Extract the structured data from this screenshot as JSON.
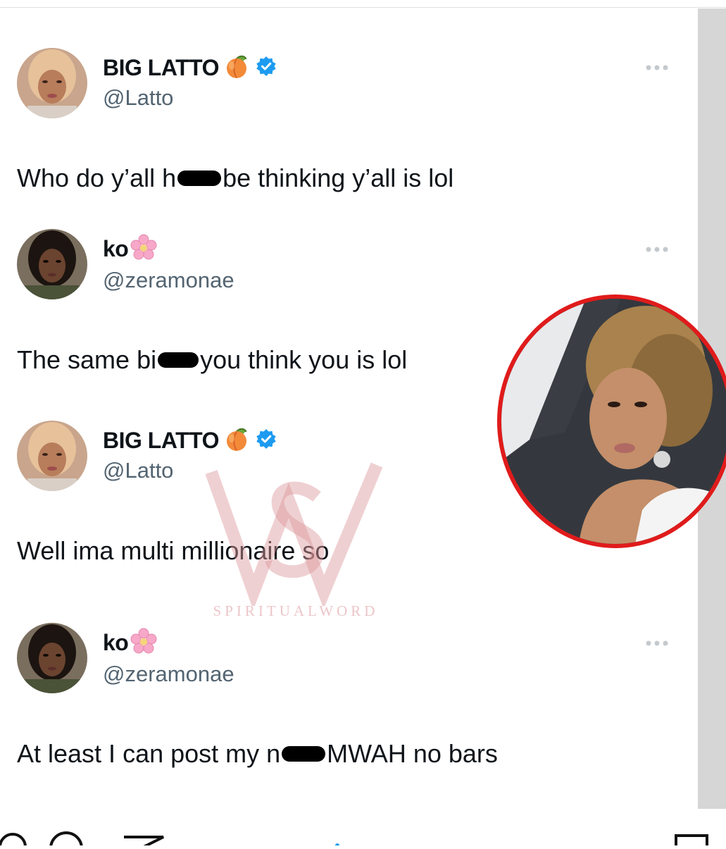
{
  "tweets": [
    {
      "name": "BIG LATTO",
      "name_emoji": "peach-emoji",
      "verified": true,
      "handle": "@Latto",
      "text_before": "Who do y’all h",
      "text_after": " be thinking y’all is lol"
    },
    {
      "name": "ko",
      "name_emoji": "cherry-blossom-emoji",
      "verified": false,
      "handle": "@zeramonae",
      "text_before": "The same bi",
      "text_after": " you think you is lol"
    },
    {
      "name": "BIG LATTO",
      "name_emoji": "peach-emoji",
      "verified": true,
      "handle": "@Latto",
      "text": "Well ima multi millionaire so"
    },
    {
      "name": "ko",
      "name_emoji": "cherry-blossom-emoji",
      "verified": false,
      "handle": "@zeramonae",
      "text_before": "At least I can post my n",
      "text_after": " MWAH no bars"
    }
  ],
  "watermark": {
    "text": "SPIRITUALWORD"
  },
  "colors": {
    "verified_blue": "#1d9bf0",
    "handle_gray": "#536471",
    "inset_ring_red": "#e01b1b",
    "watermark_pink": "#dc969b"
  },
  "icons": {
    "more": "more-horizontal-icon",
    "verified": "verified-badge-icon"
  }
}
